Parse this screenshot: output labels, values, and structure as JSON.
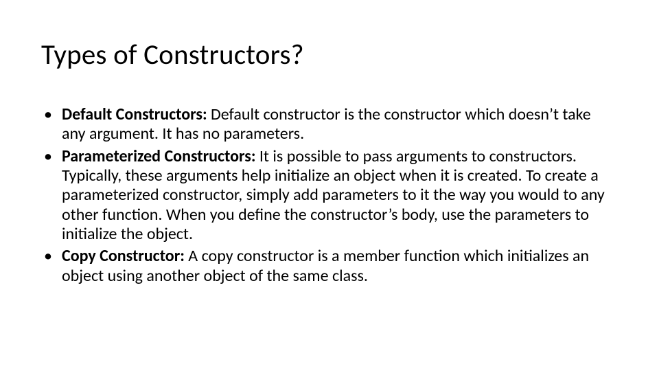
{
  "title": "Types of Constructors?",
  "bullets": [
    {
      "bold": "Default Constructors: ",
      "rest": "Default constructor is the constructor which doesn’t take any argument. It has no parameters."
    },
    {
      "bold": "Parameterized Constructors: ",
      "rest": "It is possible to pass arguments to constructors. Typically, these arguments help initialize an object when it is created. To create a parameterized constructor, simply add parameters to it the way you would to any other function. When you define the constructor’s body, use the parameters to initialize the object."
    },
    {
      "bold": "Copy Constructor: ",
      "rest": "A copy constructor is a member function which initializes an object using another object of the same class."
    }
  ]
}
